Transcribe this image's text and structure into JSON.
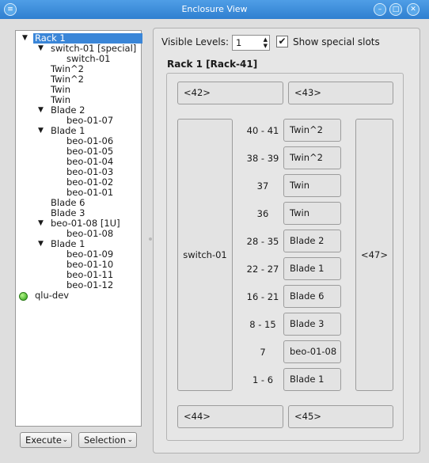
{
  "window": {
    "title": "Enclosure View"
  },
  "titlebar_icons": [
    "menu-icon",
    "minimize-icon",
    "maximize-icon",
    "close-icon"
  ],
  "tree": [
    {
      "label": "Rack 1",
      "level": 0,
      "expanded": true,
      "selected": true
    },
    {
      "label": "switch-01 [special]",
      "level": 1,
      "expanded": true
    },
    {
      "label": "switch-01",
      "level": 2
    },
    {
      "label": "Twin^2",
      "level": 1
    },
    {
      "label": "Twin^2",
      "level": 1
    },
    {
      "label": "Twin",
      "level": 1
    },
    {
      "label": "Twin",
      "level": 1
    },
    {
      "label": "Blade 2",
      "level": 1,
      "expanded": true
    },
    {
      "label": "beo-01-07",
      "level": 2
    },
    {
      "label": "Blade 1",
      "level": 1,
      "expanded": true
    },
    {
      "label": "beo-01-06",
      "level": 2
    },
    {
      "label": "beo-01-05",
      "level": 2
    },
    {
      "label": "beo-01-04",
      "level": 2
    },
    {
      "label": "beo-01-03",
      "level": 2
    },
    {
      "label": "beo-01-02",
      "level": 2
    },
    {
      "label": "beo-01-01",
      "level": 2
    },
    {
      "label": "Blade 6",
      "level": 1
    },
    {
      "label": "Blade 3",
      "level": 1
    },
    {
      "label": "beo-01-08 [1U]",
      "level": 1,
      "expanded": true
    },
    {
      "label": "beo-01-08",
      "level": 2
    },
    {
      "label": "Blade 1",
      "level": 1,
      "expanded": true
    },
    {
      "label": "beo-01-09",
      "level": 2
    },
    {
      "label": "beo-01-10",
      "level": 2
    },
    {
      "label": "beo-01-11",
      "level": 2
    },
    {
      "label": "beo-01-12",
      "level": 2
    },
    {
      "label": "qlu-dev",
      "level": 0,
      "status": "online"
    }
  ],
  "buttons": {
    "execute": "Execute",
    "selection": "Selection"
  },
  "controls": {
    "visible_levels_label": "Visible Levels:",
    "visible_levels_value": "1",
    "show_special_label": "Show special slots",
    "show_special_checked": true,
    "checkmark": "✔"
  },
  "rack": {
    "title": "Rack 1 [Rack-41]",
    "top_slots": [
      "<42>",
      "<43>"
    ],
    "bottom_slots": [
      "<44>",
      "<45>"
    ],
    "left_slot": "switch-01",
    "right_slot": "<47>",
    "rows": [
      {
        "range": "40 - 41",
        "name": "Twin^2"
      },
      {
        "range": "38 - 39",
        "name": "Twin^2"
      },
      {
        "range": "37",
        "name": "Twin"
      },
      {
        "range": "36",
        "name": "Twin"
      },
      {
        "range": "28 - 35",
        "name": "Blade 2"
      },
      {
        "range": "22 - 27",
        "name": "Blade 1"
      },
      {
        "range": "16 - 21",
        "name": "Blade 6"
      },
      {
        "range": "8 - 15",
        "name": "Blade 3"
      },
      {
        "range": "7",
        "name": "beo-01-08"
      },
      {
        "range": "1 - 6",
        "name": "Blade 1"
      }
    ]
  }
}
